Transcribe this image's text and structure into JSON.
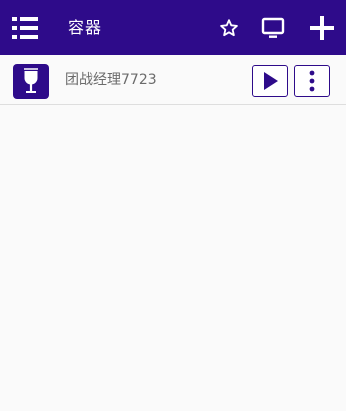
{
  "app": {
    "title": "容器"
  },
  "toolbar": {
    "icons": [
      "menu-icon",
      "star-icon",
      "screen-icon",
      "plus-icon"
    ]
  },
  "containers": [
    {
      "name": "团战经理7723",
      "icon": "wine-glass-icon",
      "actions": [
        "play-icon",
        "more-vert-icon"
      ]
    }
  ],
  "colors": {
    "primary": "#2e0b8a",
    "background": "#fafafa",
    "label": "#6b6b6b",
    "divider": "#dedede"
  }
}
